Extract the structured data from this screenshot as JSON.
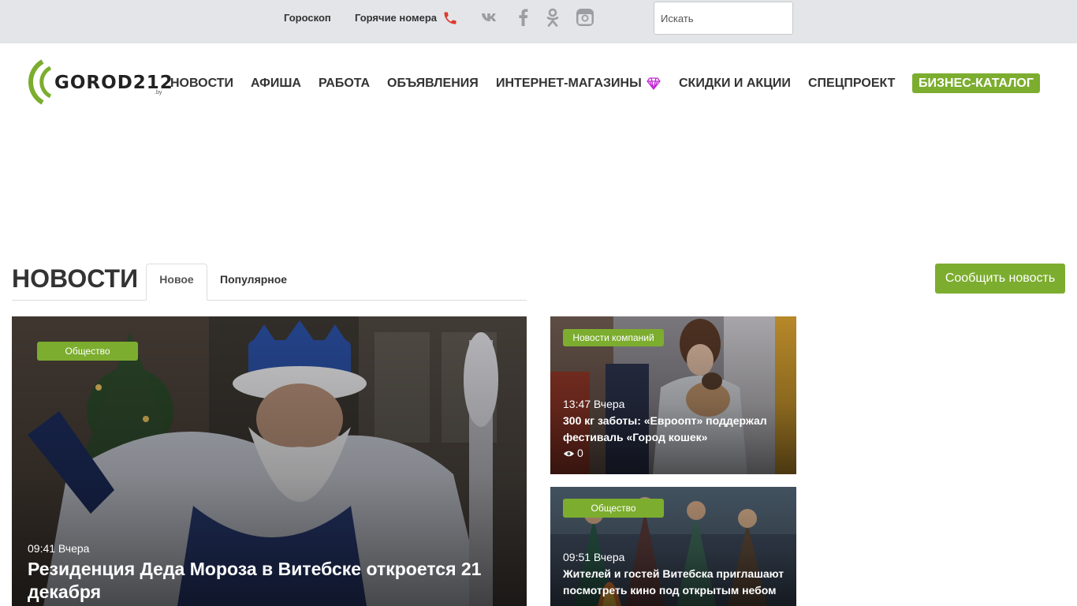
{
  "topbar": {
    "horoscope": "Гороскоп",
    "hot_numbers": "Горячие номера",
    "search": {
      "placeholder": "Искать",
      "value": ""
    },
    "socials": [
      "vk-icon",
      "facebook-icon",
      "odnoklassniki-icon",
      "instagram-icon"
    ]
  },
  "logo": {
    "text": "GOROD212",
    "domain": ".by"
  },
  "nav": {
    "items": [
      "НОВОСТИ",
      "АФИША",
      "РАБОТА",
      "ОБЪЯВЛЕНИЯ",
      "ИНТЕРНЕТ-МАГАЗИНЫ",
      "СКИДКИ И АКЦИИ",
      "СПЕЦПРОЕКТ"
    ],
    "catalog": "БИЗНЕС-КАТАЛОГ"
  },
  "news": {
    "title": "НОВОСТИ",
    "tabs": [
      "Новое",
      "Популярное"
    ],
    "report_button": "Сообщить новость"
  },
  "cards": [
    {
      "category": "Общество",
      "time": "09:41 Вчера",
      "title": "Резиденция Деда Мороза в Витебске откроется 21 декабря"
    },
    {
      "category": "Новости компаний",
      "time": "13:47 Вчера",
      "title": "300 кг заботы: «Евроопт» поддержал фестиваль «Город кошек»",
      "views": "0"
    },
    {
      "category": "Общество",
      "time": "09:51 Вчера",
      "title": "Жителей и гостей Витебска приглашают посмотреть кино под открытым небом"
    }
  ],
  "colors": {
    "accent": "#7cad2f",
    "topbar_bg": "#e3e5e8",
    "phone": "#e03a2f",
    "gem": "#c026d3"
  }
}
